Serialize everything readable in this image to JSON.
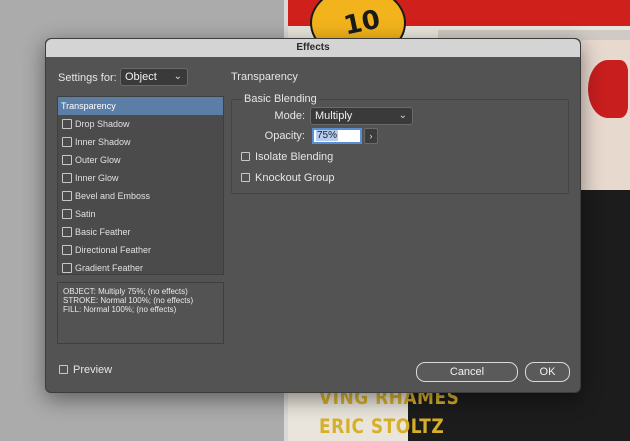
{
  "background": {
    "poster_badge": "10",
    "credits": [
      "VING RHAMES",
      "ERIC STOLTZ"
    ]
  },
  "dialog": {
    "title": "Effects",
    "settings_for_label": "Settings for:",
    "settings_for_value": "Object",
    "section_title": "Transparency",
    "effects": [
      {
        "label": "Transparency",
        "selected": true,
        "checkbox": false
      },
      {
        "label": "Drop Shadow",
        "selected": false,
        "checkbox": true
      },
      {
        "label": "Inner Shadow",
        "selected": false,
        "checkbox": true
      },
      {
        "label": "Outer Glow",
        "selected": false,
        "checkbox": true
      },
      {
        "label": "Inner Glow",
        "selected": false,
        "checkbox": true
      },
      {
        "label": "Bevel and Emboss",
        "selected": false,
        "checkbox": true
      },
      {
        "label": "Satin",
        "selected": false,
        "checkbox": true
      },
      {
        "label": "Basic Feather",
        "selected": false,
        "checkbox": true
      },
      {
        "label": "Directional Feather",
        "selected": false,
        "checkbox": true
      },
      {
        "label": "Gradient Feather",
        "selected": false,
        "checkbox": true
      }
    ],
    "summary": [
      "OBJECT: Multiply 75%; (no effects)",
      "STROKE: Normal 100%; (no effects)",
      "FILL: Normal 100%; (no effects)"
    ],
    "basic_blending": {
      "title": "Basic Blending",
      "mode_label": "Mode:",
      "mode_value": "Multiply",
      "opacity_label": "Opacity:",
      "opacity_value": "75%",
      "isolate_blending_label": "Isolate Blending",
      "knockout_group_label": "Knockout Group"
    },
    "preview_label": "Preview",
    "cancel_label": "Cancel",
    "ok_label": "OK"
  },
  "colors": {
    "dialog_bg": "#535353",
    "selection": "#5a7ea6",
    "focus_ring": "#5a8ed0",
    "poster_red": "#d0201c",
    "credit_gold": "#d7b02a"
  }
}
